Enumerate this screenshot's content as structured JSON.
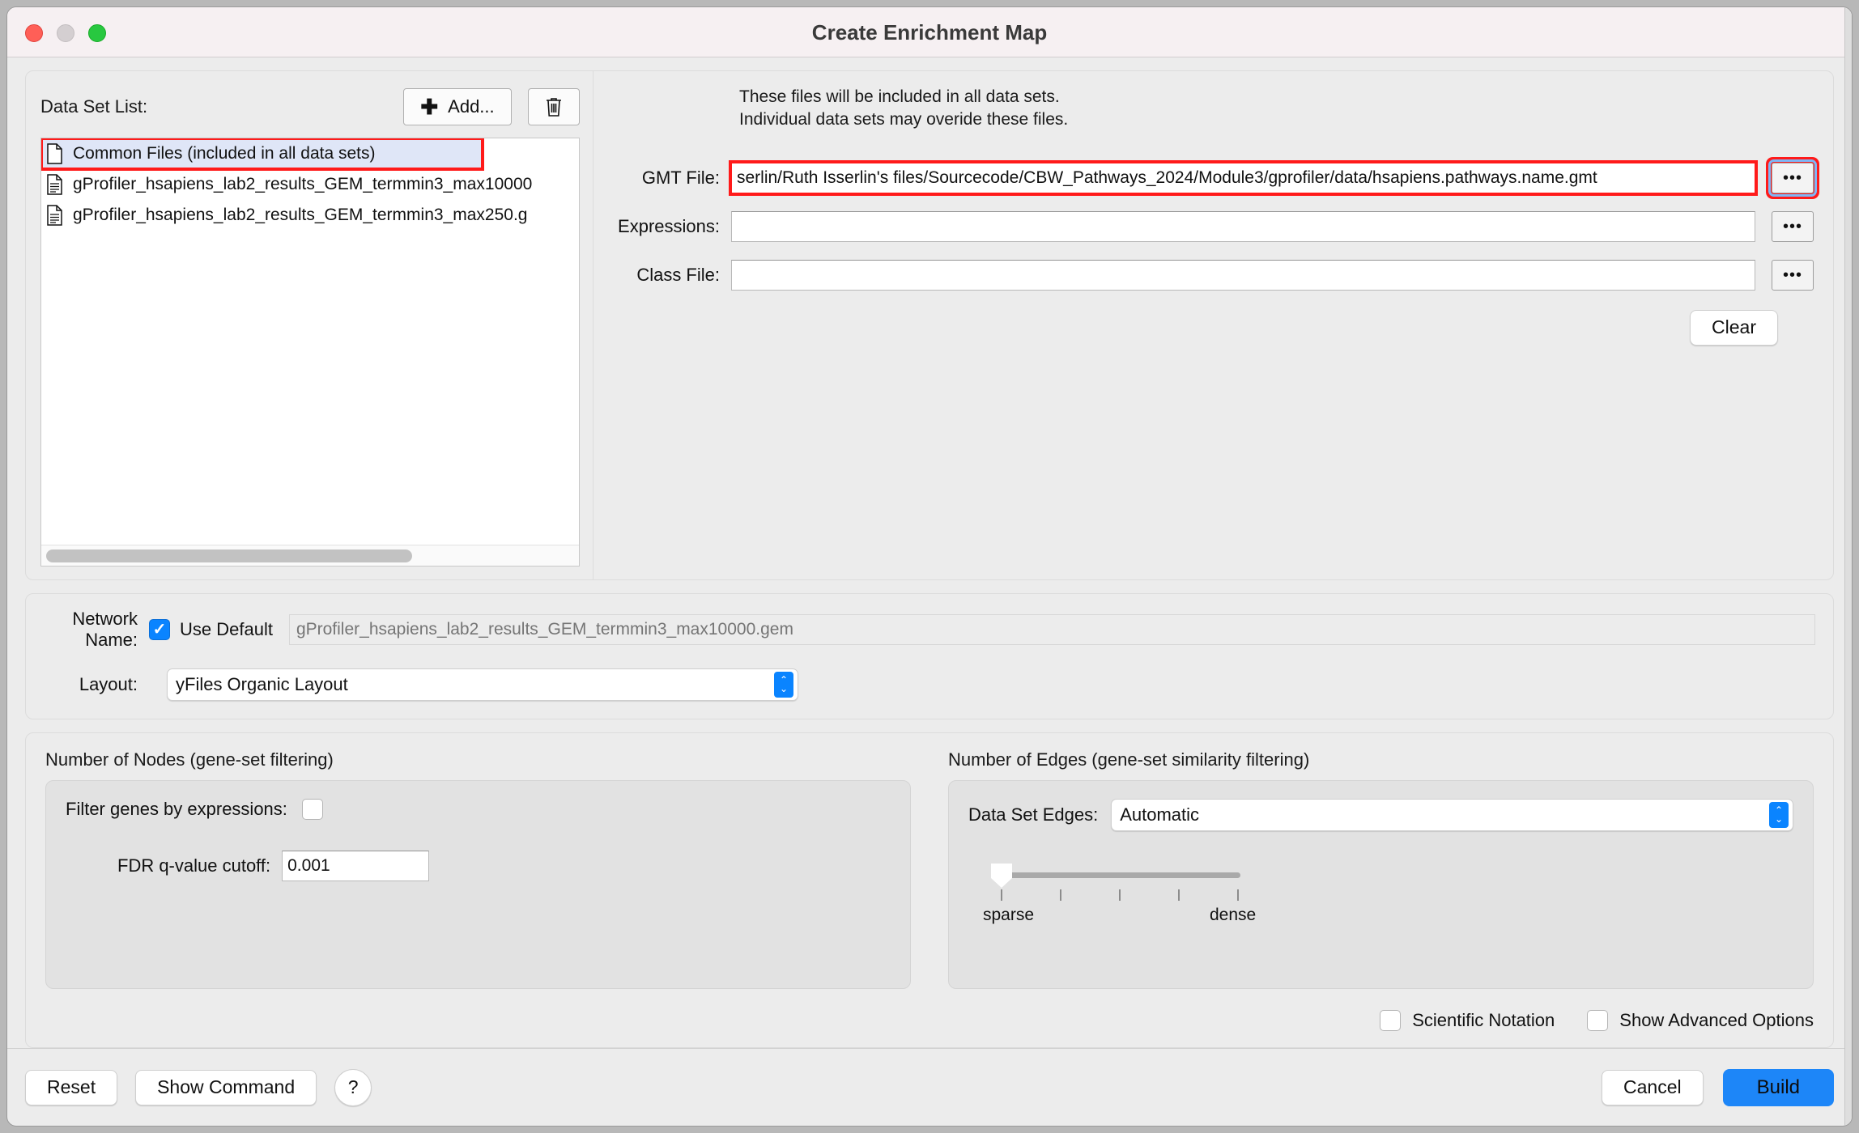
{
  "window": {
    "title": "Create Enrichment Map",
    "traffic_lights": [
      "close",
      "minimize",
      "zoom"
    ]
  },
  "dataset_panel": {
    "label": "Data Set List:",
    "add_button": "Add...",
    "delete_button_icon": "trash-icon",
    "items": [
      {
        "label": "Common Files (included in all data sets)",
        "icon": "blank-file-icon",
        "selected": true,
        "highlighted": true
      },
      {
        "label": "gProfiler_hsapiens_lab2_results_GEM_termmin3_max10000",
        "icon": "text-file-icon",
        "selected": false,
        "highlighted": false
      },
      {
        "label": "gProfiler_hsapiens_lab2_results_GEM_termmin3_max250.g",
        "icon": "text-file-icon",
        "selected": false,
        "highlighted": false
      }
    ]
  },
  "common_files": {
    "note_line1": "These files will be included in all data sets.",
    "note_line2": "Individual data sets may overide these files.",
    "gmt_label": "GMT File:",
    "gmt_value": "serlin/Ruth Isserlin's files/Sourcecode/CBW_Pathways_2024/Module3/gprofiler/data/hsapiens.pathways.name.gmt",
    "expressions_label": "Expressions:",
    "expressions_value": "",
    "class_label": "Class File:",
    "class_value": "",
    "browse_button": "•••",
    "clear_button": "Clear"
  },
  "network": {
    "name_label": "Network Name:",
    "use_default_label": "Use Default",
    "use_default_checked": true,
    "name_placeholder": "gProfiler_hsapiens_lab2_results_GEM_termmin3_max10000.gem",
    "layout_label": "Layout:",
    "layout_value": "yFiles Organic Layout"
  },
  "nodes": {
    "title": "Number of Nodes (gene-set filtering)",
    "filter_genes_label": "Filter genes by expressions:",
    "filter_genes_checked": false,
    "fdr_label": "FDR q-value cutoff:",
    "fdr_value": "0.001"
  },
  "edges": {
    "title": "Number of Edges (gene-set similarity filtering)",
    "data_set_edges_label": "Data Set Edges:",
    "data_set_edges_value": "Automatic",
    "slider_min_label": "sparse",
    "slider_max_label": "dense",
    "slider_position_percent": 0
  },
  "options": {
    "scientific_notation_label": "Scientific Notation",
    "scientific_notation_checked": false,
    "show_advanced_label": "Show Advanced Options",
    "show_advanced_checked": false
  },
  "footer": {
    "reset": "Reset",
    "show_command": "Show Command",
    "help": "?",
    "cancel": "Cancel",
    "build": "Build"
  },
  "colors": {
    "accent_blue": "#0a84ff",
    "build_blue": "#1d86f8",
    "highlight_red": "#ff1a1a",
    "selection_blue": "#dfe6f7"
  }
}
